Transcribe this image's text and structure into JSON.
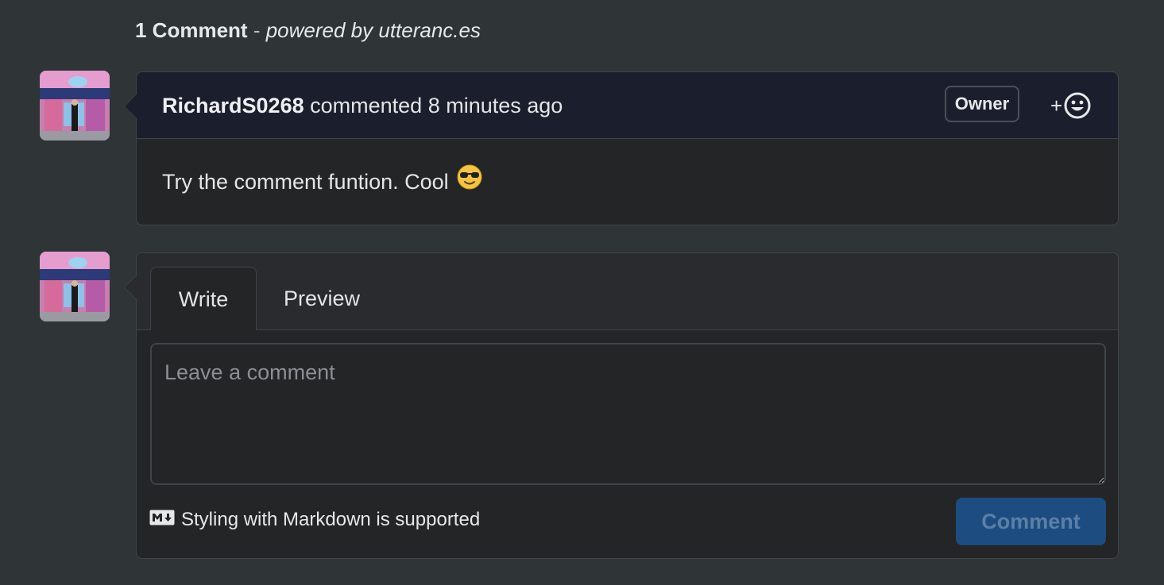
{
  "header": {
    "count_label": "1 Comment",
    "separator": "-",
    "powered_by": "powered by utteranc.es"
  },
  "comment": {
    "author": "RichardS0268",
    "meta": "commented 8 minutes ago",
    "badge": "Owner",
    "reaction_plus": "+",
    "reaction_icon": "smiley-icon",
    "body": "Try the comment funtion. Cool",
    "body_emoji": "sunglasses-face-emoji"
  },
  "editor": {
    "tabs": [
      {
        "label": "Write",
        "selected": true
      },
      {
        "label": "Preview",
        "selected": false
      }
    ],
    "placeholder": "Leave a comment",
    "value": "",
    "markdown_note": "Styling with Markdown is supported",
    "markdown_icon": "markdown-icon",
    "submit_label": "Comment",
    "submit_disabled": true
  },
  "colors": {
    "background": "#2f3437",
    "card": "#242527",
    "comment_header": "#1b1f2d",
    "submit_button": "#1c4c80",
    "border": "#3f4448"
  }
}
